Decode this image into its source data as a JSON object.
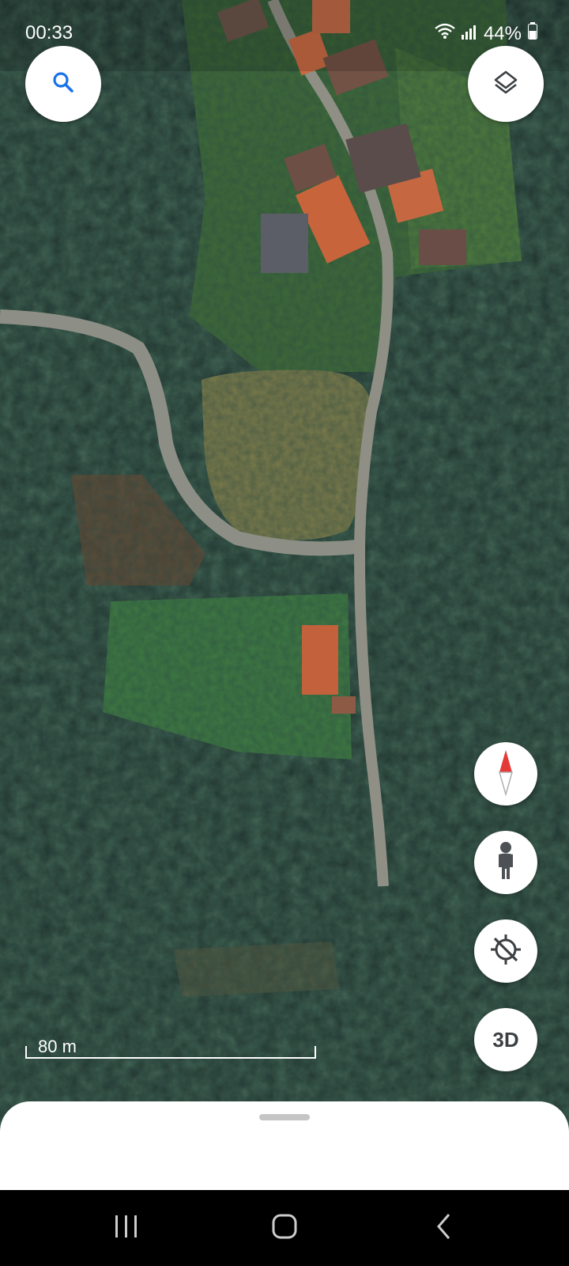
{
  "status_bar": {
    "time": "00:33",
    "battery": "44%"
  },
  "map": {
    "type": "satellite",
    "scale_label": "80 m"
  },
  "buttons": {
    "search_icon": "search-icon",
    "layers_icon": "layers-icon",
    "compass_icon": "compass-icon",
    "street_view_icon": "pegman-icon",
    "my_location_icon": "location-disabled-icon",
    "three_d_label": "3D"
  },
  "nav_bar": {
    "recents": "recents-icon",
    "home": "home-icon",
    "back": "back-icon"
  },
  "colors": {
    "accent_blue": "#1a73e8",
    "compass_red": "#e53935"
  }
}
